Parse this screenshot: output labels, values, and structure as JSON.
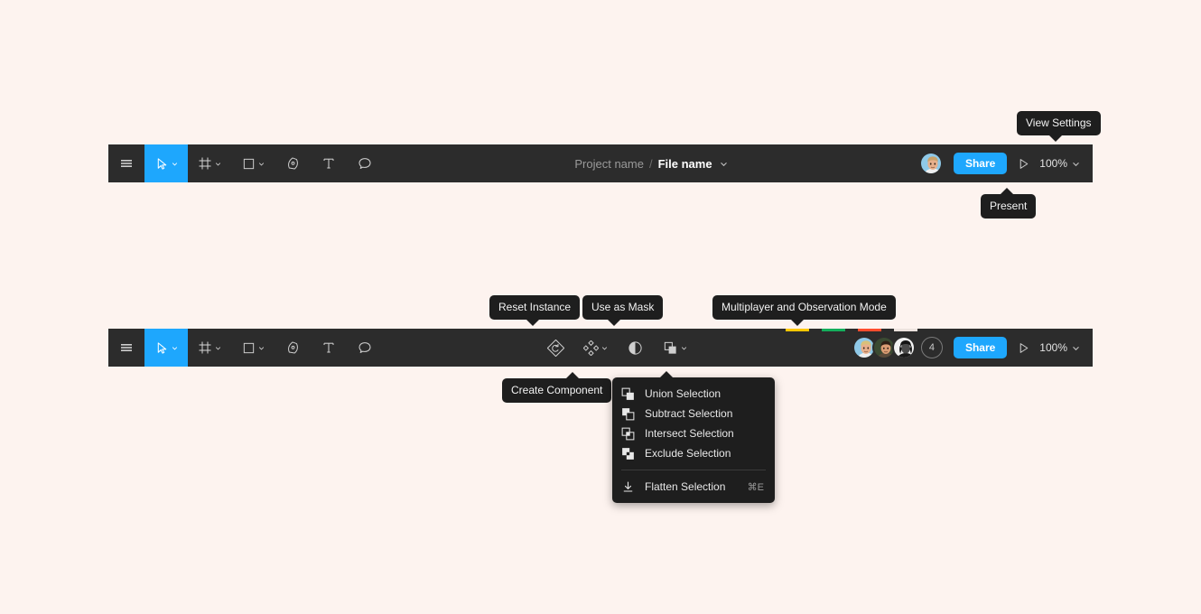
{
  "canvas": {
    "background_color": "#FDF3EF"
  },
  "theme": {
    "toolbar_bg": "#2C2C2C",
    "accent_blue": "#1EA7FD",
    "tooltip_bg": "#1E1E1E",
    "menu_bg": "#1E1E1E"
  },
  "toolbar_top": {
    "tools": [
      {
        "name": "main-menu",
        "icon": "hamburger-icon",
        "label": "Menu",
        "has_chevron": false,
        "active": false
      },
      {
        "name": "move-tool",
        "icon": "cursor-icon",
        "label": "Move",
        "has_chevron": true,
        "active": true
      },
      {
        "name": "frame-tool",
        "icon": "frame-icon",
        "label": "Frame",
        "has_chevron": true,
        "active": false
      },
      {
        "name": "shape-tool",
        "icon": "square-icon",
        "label": "Shape",
        "has_chevron": true,
        "active": false
      },
      {
        "name": "pen-tool",
        "icon": "pen-icon",
        "label": "Pen",
        "has_chevron": false,
        "active": false
      },
      {
        "name": "text-tool",
        "icon": "text-icon",
        "label": "Text",
        "has_chevron": false,
        "active": false
      },
      {
        "name": "comment-tool",
        "icon": "comment-icon",
        "label": "Comment",
        "has_chevron": false,
        "active": false
      }
    ],
    "file": {
      "project_name": "Project name",
      "separator": "/",
      "file_name": "File name",
      "chevron": "chevron-down-icon"
    },
    "share_label": "Share",
    "zoom_level": "100%",
    "present_icon": "play-icon",
    "avatars": [
      {
        "name": "avatar-user-1",
        "hair": "#D8B27A",
        "skin": "#E8B08C",
        "bg": "#8FC9E8",
        "shirt": "#F2F2F2"
      }
    ]
  },
  "toolbar_bottom": {
    "tools": [
      {
        "name": "main-menu",
        "icon": "hamburger-icon",
        "label": "Menu",
        "has_chevron": false,
        "active": false
      },
      {
        "name": "move-tool",
        "icon": "cursor-icon",
        "label": "Move",
        "has_chevron": true,
        "active": true
      },
      {
        "name": "frame-tool",
        "icon": "frame-icon",
        "label": "Frame",
        "has_chevron": true,
        "active": false
      },
      {
        "name": "shape-tool",
        "icon": "square-icon",
        "label": "Shape",
        "has_chevron": true,
        "active": false
      },
      {
        "name": "pen-tool",
        "icon": "pen-icon",
        "label": "Pen",
        "has_chevron": false,
        "active": false
      },
      {
        "name": "text-tool",
        "icon": "text-icon",
        "label": "Text",
        "has_chevron": false,
        "active": false
      },
      {
        "name": "comment-tool",
        "icon": "comment-icon",
        "label": "Comment",
        "has_chevron": false,
        "active": false
      }
    ],
    "selection_tools": [
      {
        "name": "reset-instance-button",
        "icon": "reset-instance-icon",
        "label": "Reset Instance",
        "has_chevron": false
      },
      {
        "name": "create-component-button",
        "icon": "component-icon",
        "label": "Create Component",
        "has_chevron": true
      },
      {
        "name": "use-as-mask-button",
        "icon": "mask-icon",
        "label": "Use as Mask",
        "has_chevron": false
      },
      {
        "name": "boolean-groups-button",
        "icon": "boolean-union-icon",
        "label": "Boolean groups",
        "has_chevron": true
      }
    ],
    "share_label": "Share",
    "zoom_level": "100%",
    "present_icon": "play-icon",
    "collaborator_overflow_count": "4",
    "avatars": [
      {
        "name": "avatar-user-1",
        "bar_color": "#FFC800",
        "bg": "#8FC9E8",
        "skin": "#E8B08C",
        "hair": "#D8C07A"
      },
      {
        "name": "avatar-user-2",
        "bar_color": "#14AE5C",
        "bg": "#2E4A2E",
        "skin": "#D99C74",
        "hair": "#3A2A1E"
      },
      {
        "name": "avatar-user-3",
        "bar_color": "#FF4D2E",
        "bg": "#F2F2F2",
        "skin": "#3A3A3A",
        "hair": "#1A1A1A"
      },
      {
        "name": "avatar-overflow",
        "bar_color": "#EDE3DE",
        "bg": "#2C2C2C",
        "skin": "#2C2C2C",
        "hair": "#2C2C2C"
      }
    ]
  },
  "tooltips": [
    {
      "name": "tooltip-view-settings",
      "text": "View Settings",
      "direction": "down"
    },
    {
      "name": "tooltip-present",
      "text": "Present",
      "direction": "up"
    },
    {
      "name": "tooltip-reset-instance",
      "text": "Reset Instance",
      "direction": "down"
    },
    {
      "name": "tooltip-use-as-mask",
      "text": "Use as Mask",
      "direction": "down"
    },
    {
      "name": "tooltip-multiplayer",
      "text": "Multiplayer and Observation Mode",
      "direction": "down"
    },
    {
      "name": "tooltip-create-component",
      "text": "Create Component",
      "direction": "up"
    }
  ],
  "boolean_menu": {
    "items": [
      {
        "name": "menu-item-union-selection",
        "icon": "boolean-union-icon",
        "label": "Union Selection",
        "shortcut": ""
      },
      {
        "name": "menu-item-subtract-selection",
        "icon": "boolean-subtract-icon",
        "label": "Subtract Selection",
        "shortcut": ""
      },
      {
        "name": "menu-item-intersect-selection",
        "icon": "boolean-intersect-icon",
        "label": "Intersect Selection",
        "shortcut": ""
      },
      {
        "name": "menu-item-exclude-selection",
        "icon": "boolean-exclude-icon",
        "label": "Exclude Selection",
        "shortcut": ""
      }
    ],
    "footer_items": [
      {
        "name": "menu-item-flatten-selection",
        "icon": "flatten-icon",
        "label": "Flatten Selection",
        "shortcut": "⌘E"
      }
    ]
  }
}
